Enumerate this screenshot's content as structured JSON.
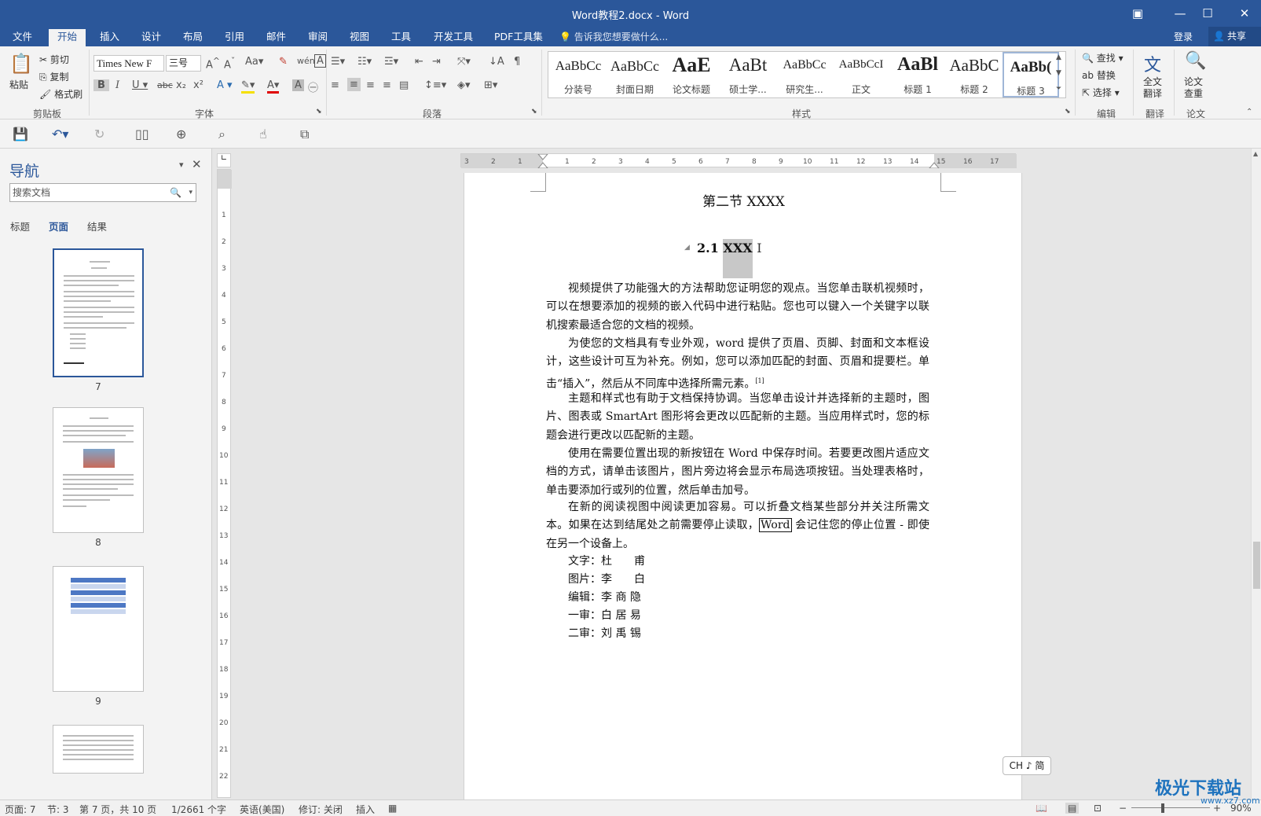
{
  "window": {
    "title": "Word教程2.docx - Word"
  },
  "tabs": [
    "文件",
    "开始",
    "插入",
    "设计",
    "布局",
    "引用",
    "邮件",
    "审阅",
    "视图",
    "工具",
    "开发工具",
    "PDF工具集"
  ],
  "active_tab": "开始",
  "tell_me": "告诉我您想要做什么...",
  "account": {
    "login": "登录",
    "share": "共享"
  },
  "clipboard": {
    "paste": "粘贴",
    "cut": "剪切",
    "copy": "复制",
    "format_painter": "格式刷",
    "label": "剪贴板"
  },
  "font": {
    "name": "Times New F",
    "size": "三号",
    "label": "字体"
  },
  "paragraph": {
    "label": "段落"
  },
  "styles": {
    "label": "样式",
    "items": [
      {
        "preview": "AaBbCc",
        "name": "分装号"
      },
      {
        "preview": "AaBbCc",
        "name": "封面日期"
      },
      {
        "preview": "AaE",
        "name": "论文标题"
      },
      {
        "preview": "AaBt",
        "name": "硕士学..."
      },
      {
        "preview": "AaBbCc",
        "name": "研究生..."
      },
      {
        "preview": "AaBbCcI",
        "name": "正文"
      },
      {
        "preview": "AaBl",
        "name": "标题 1"
      },
      {
        "preview": "AaBbC",
        "name": "标题 2"
      },
      {
        "preview": "AaBb(",
        "name": "标题 3"
      }
    ]
  },
  "editing": {
    "find": "查找",
    "replace": "替换",
    "select": "选择",
    "label": "编辑"
  },
  "translate": {
    "btn": "全文\n翻译",
    "label": "翻译"
  },
  "paper": {
    "btn": "论文\n查重",
    "label": "论文"
  },
  "nav": {
    "title": "导航",
    "search_placeholder": "搜索文档",
    "tabs": [
      "标题",
      "页面",
      "结果"
    ],
    "active_tab": "页面",
    "pages": [
      "7",
      "8",
      "9"
    ]
  },
  "document": {
    "section_title": "第二节  XXXX",
    "heading": "2.1",
    "heading_selected": "XXX",
    "paragraphs": [
      "视频提供了功能强大的方法帮助您证明您的观点。当您单击联机视频时，可以在想要添加的视频的嵌入代码中进行粘贴。您也可以键入一个关键字以联机搜索最适合您的文档的视频。",
      "为使您的文档具有专业外观，word 提供了页眉、页脚、封面和文本框设计，这些设计可互为补充。例如，您可以添加匹配的封面、页眉和提要栏。单击“插入”，然后从不同库中选择所需元素。",
      "主题和样式也有助于文档保持协调。当您单击设计并选择新的主题时，图片、图表或 SmartArt 图形将会更改以匹配新的主题。当应用样式时，您的标题会进行更改以匹配新的主题。",
      "使用在需要位置出现的新按钮在 Word 中保存时间。若要更改图片适应文档的方式，请单击该图片，图片旁边将会显示布局选项按钮。当处理表格时，单击要添加行或列的位置，然后单击加号。"
    ],
    "footnote_mark": "[1]",
    "p5_before": "在新的阅读视图中阅读更加容易。可以折叠文档某些部分并关注所需文本。如果在达到结尾处之前需要停止读取，",
    "p5_boxed": "Word",
    "p5_after": " 会记住您的停止位置 - 即使在另一个设备上。",
    "credits": [
      {
        "role": "文字：",
        "name": "杜　　甫"
      },
      {
        "role": "图片：",
        "name": "李　　白"
      },
      {
        "role": "编辑：",
        "name": "李 商 隐"
      },
      {
        "role": "一审：",
        "name": "白 居 易"
      },
      {
        "role": "二审：",
        "name": "刘 禹 锡"
      }
    ]
  },
  "ime": "CH ♪ 简",
  "status": {
    "page": "页面: 7",
    "section": "节: 3",
    "page_of": "第 7 页，共 10 页",
    "words": "1/2661 个字",
    "language": "英语(美国)",
    "track": "修订: 关闭",
    "mode": "插入",
    "zoom": "90%"
  },
  "watermark": {
    "text": "极光下载站",
    "url": "www.xz7.com"
  }
}
